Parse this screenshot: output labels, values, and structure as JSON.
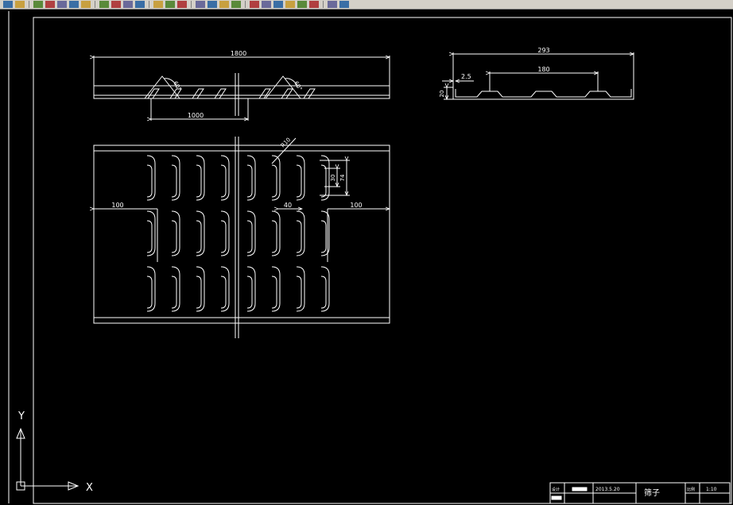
{
  "toolbar": {
    "icons": [
      "open-folder-icon",
      "save-icon",
      "print-icon",
      "plot-preview-icon",
      "publish-icon",
      "3d-print-icon",
      "cut-icon",
      "copy-icon",
      "paste-icon",
      "match-properties-icon",
      "block-editor-icon",
      "undo-icon",
      "redo-icon",
      "pan-icon",
      "zoom-realtime-icon",
      "zoom-window-icon",
      "zoom-previous-icon",
      "properties-icon",
      "design-center-icon",
      "tool-palettes-icon",
      "sheet-set-icon",
      "markup-icon",
      "quickcalc-icon",
      "help-icon",
      "layer-properties-icon",
      "layer-state-icon"
    ]
  },
  "drawing": {
    "top_view": {
      "dim_overall": "1800",
      "angle_left": "60°",
      "angle_right": "60°",
      "dim_bottom": "1000"
    },
    "section_view": {
      "dim_overall": "293",
      "dim_thickness": "2.5",
      "dim_pitch": "180",
      "dim_height": "20"
    },
    "plan_view": {
      "radius_label": "R10",
      "dim_slot_width": "30",
      "dim_slot_length": "74",
      "dim_spacing": "40",
      "dim_left_margin": "100",
      "dim_right_margin": "100"
    },
    "ucs": {
      "x_label": "X",
      "y_label": "Y"
    },
    "title_block": {
      "label_design": "设计",
      "date": "2013.5.20",
      "part_name": "筛子",
      "label_scale": "比例",
      "scale": "1:10"
    }
  },
  "colors": {
    "background": "#000000",
    "lines": "#ffffff",
    "toolbar": "#d4d0c8"
  }
}
